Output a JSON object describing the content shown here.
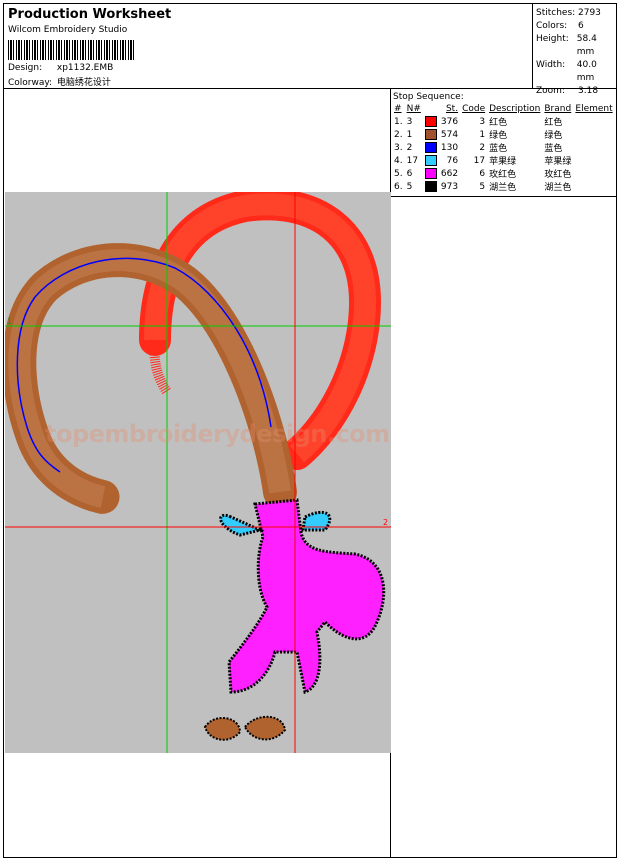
{
  "header": {
    "title": "Production Worksheet",
    "company": "Wilcom Embroidery Studio",
    "design_label": "Design:",
    "design_value": "xp1132.EMB",
    "colorway_label": "Colorway:",
    "colorway_value": "电脑绣花设计"
  },
  "stats": {
    "stitches_label": "Stitches:",
    "stitches_value": "2793",
    "colors_label": "Colors:",
    "colors_value": "6",
    "height_label": "Height:",
    "height_value": "58.4 mm",
    "width_label": "Width:",
    "width_value": "40.0 mm",
    "zoom_label": "Zoom:",
    "zoom_value": "3.18"
  },
  "stop_sequence": {
    "title": "Stop Sequence:",
    "columns": [
      "#",
      "N#",
      "St.",
      "Code",
      "Description",
      "Brand",
      "Element"
    ],
    "rows": [
      {
        "idx": "1.",
        "n": "3",
        "color": "#ff0000",
        "st": "376",
        "code": "3",
        "desc": "红色",
        "brand": "红色"
      },
      {
        "idx": "2.",
        "n": "1",
        "color": "#a0522d",
        "st": "574",
        "code": "1",
        "desc": "绿色",
        "brand": "绿色"
      },
      {
        "idx": "3.",
        "n": "2",
        "color": "#0000ff",
        "st": "130",
        "code": "2",
        "desc": "蓝色",
        "brand": "蓝色"
      },
      {
        "idx": "4.",
        "n": "17",
        "color": "#33ccff",
        "st": "76",
        "code": "17",
        "desc": "苹果绿",
        "brand": "苹果绿"
      },
      {
        "idx": "5.",
        "n": "6",
        "color": "#ff00ff",
        "st": "662",
        "code": "6",
        "desc": "玫红色",
        "brand": "玫红色"
      },
      {
        "idx": "6.",
        "n": "5",
        "color": "#000000",
        "st": "973",
        "code": "5",
        "desc": "湖兰色",
        "brand": "湖兰色"
      }
    ]
  },
  "canvas": {
    "background": "#c0c0c0",
    "watermark": "topembroiderydesign.com",
    "marker_h": "1",
    "marker_v": "2"
  }
}
